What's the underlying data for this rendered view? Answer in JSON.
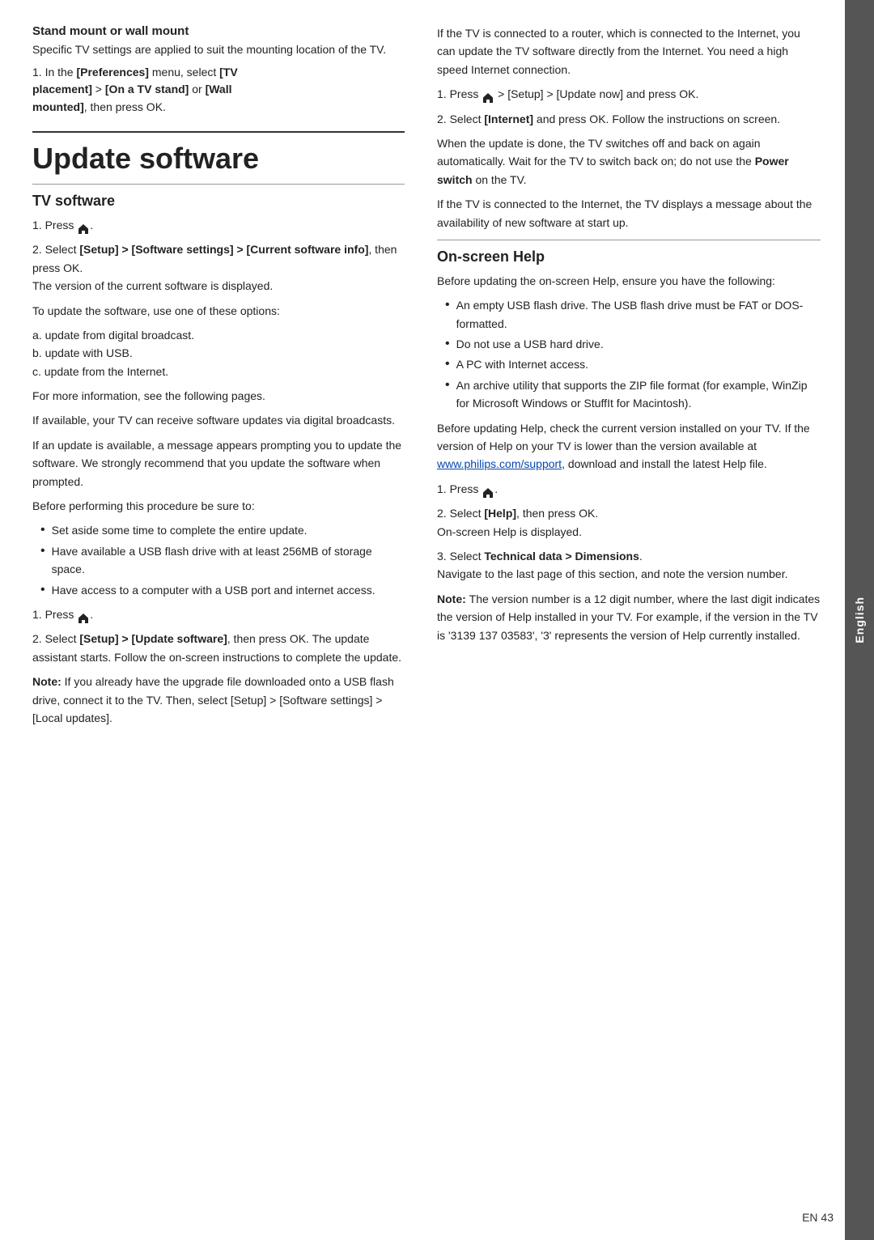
{
  "page": {
    "page_number": "EN 43",
    "language_tab": "English"
  },
  "left_column": {
    "stand_mount": {
      "title": "Stand mount or wall mount",
      "body1": "Specific TV settings are applied to suit the mounting location of the TV.",
      "body2": "1. In the [Preferences] menu, select [TV placement] > [On a TV stand] or [Wall mounted], then press OK."
    },
    "divider": true,
    "main_heading": "Update software",
    "tv_software": {
      "title": "TV software",
      "step1": "1. Press",
      "step2_prefix": "2. Select ",
      "step2_brackets": "[Setup] > [Software settings] > [Current software info]",
      "step2_suffix": ", then press OK.",
      "step2_body": "The version of the current software is displayed.",
      "update_intro": "To update the software, use one of these options:",
      "options": [
        "a. update from digital broadcast.",
        "b. update with USB.",
        "c. update from the Internet."
      ],
      "more_info": "For more information, see the following pages.",
      "digital_broadcast": "If available, your TV can receive software updates via digital broadcasts.",
      "message_text": "If an update is available, a message appears prompting you to update the software. We strongly recommend that you update the software when prompted.",
      "before_procedure": "Before performing this procedure be sure to:",
      "before_list": [
        "Set aside some time to complete the entire update.",
        "Have available a USB flash drive with at least 256MB of storage space.",
        "Have access to a computer with a USB port and internet access."
      ],
      "usb_step1": "1. Press",
      "usb_step2_prefix": "2. Select ",
      "usb_step2_brackets": "[Setup] > [Update software]",
      "usb_step2_suffix": ", then press OK. The update assistant starts. Follow the on-screen instructions to complete the update.",
      "note_prefix": "Note: ",
      "note_body": "If you already have the upgrade file downloaded onto a USB flash drive, connect it to the TV. Then, select [Setup] > [Software settings] > [Local updates]."
    }
  },
  "right_column": {
    "internet_update": {
      "intro": "If the TV is connected to a router, which is connected to the Internet, you can update the TV software directly from the Internet. You need a high speed Internet connection.",
      "step1_prefix": "1. Press",
      "step1_suffix": " > [Setup] > [Update now] and press OK.",
      "step2": "2. Select [Internet] and press OK. Follow the instructions on screen.",
      "after_update": "When the update is done, the TV switches off and back on again automatically. Wait for the TV to switch back on; do not use the Power switch on the TV.",
      "connected_message": "If the TV is connected to the Internet, the TV displays a message about the availability of new software at start up."
    },
    "on_screen_help": {
      "title": "On-screen Help",
      "before_text": "Before updating the on-screen Help, ensure you have the following:",
      "requirements": [
        "An empty USB flash drive. The USB flash drive must be FAT or DOS-formatted.",
        "Do not use a USB hard drive.",
        "A PC with Internet access.",
        "An archive utility that supports the ZIP file format (for example, WinZip for Microsoft Windows or StuffIt for Macintosh)."
      ],
      "check_text": "Before updating Help, check the current version installed on your TV. If the version of Help on your TV is lower than the version available at www.philips.com/support, download and install the latest Help file.",
      "link_text": "www.philips.com/support",
      "help_step1": "1. Press",
      "help_step2": "2. Select [Help], then press OK.",
      "help_step2_body": "On-screen Help is displayed.",
      "help_step3_bold": "3. Select Technical data > Dimensions.",
      "help_step3_body": "Navigate to the last page of this section, and note the version number.",
      "note_prefix": "Note: ",
      "note_body": "The version number is a 12 digit number, where the last digit indicates the version of Help installed in your TV. For example, if the version in the TV is '3139 137 03583', '3' represents the version of Help currently installed."
    }
  }
}
